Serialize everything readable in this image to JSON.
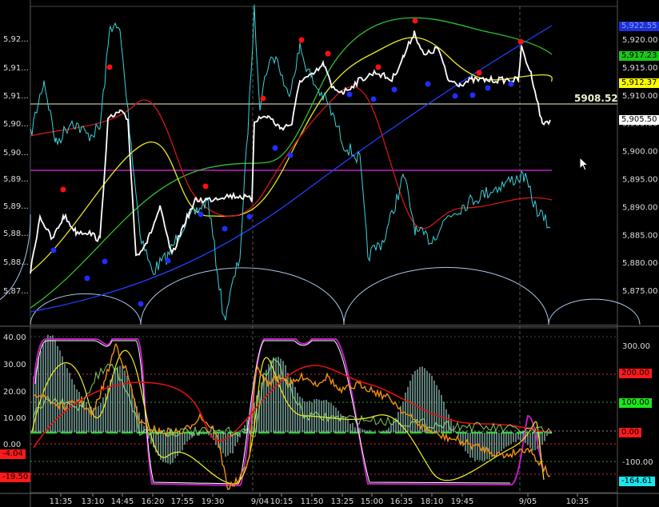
{
  "upper": {
    "y_ticks_left": [
      "5,92...",
      "5,91...",
      "5,91...",
      "5,90...",
      "5,90...",
      "5,89...",
      "5,89...",
      "5,88...",
      "5,88...",
      "5,87..."
    ],
    "y_ticks_right": [
      "5,920.00",
      "5,915.00",
      "5,910.00",
      "5,905.00",
      "5,900.00",
      "5,895.00",
      "5,890.00",
      "5,885.00",
      "5,880.00",
      "5,875.00"
    ],
    "ylim": [
      5871,
      5925
    ],
    "price_line_label": "5908.52",
    "price_line_value": 5908.52,
    "magenta_line_value": 5896.2,
    "right_tags": [
      {
        "text": "5,922.55",
        "value": 5922.55,
        "bg": "#1f2fd8",
        "fg": "#8aa0ff"
      },
      {
        "text": "5,917.23",
        "value": 5917.23,
        "bg": "#19c819",
        "fg": "#000000"
      },
      {
        "text": "5,912.37",
        "value": 5912.37,
        "bg": "#ffff00",
        "fg": "#000000"
      },
      {
        "text": "5,905.50",
        "value": 5905.5,
        "bg": "#ffffff",
        "fg": "#000000"
      }
    ]
  },
  "lower": {
    "y_ticks_left": [
      "40.00",
      "30.00",
      "20.00",
      "10.00",
      "0.00"
    ],
    "y_ticks_right": [
      "300.00",
      "-100.00"
    ],
    "left_tags": [
      {
        "text": "-4.04",
        "bg": "#ff1a1a",
        "fg": "#000000"
      },
      {
        "text": "-19.50",
        "bg": "#ff1a1a",
        "fg": "#000000"
      }
    ],
    "right_tags": [
      {
        "text": "200.00",
        "bg": "#ff1a1a",
        "fg": "#000000"
      },
      {
        "text": "100.00",
        "bg": "#19e619",
        "fg": "#000000"
      },
      {
        "text": "0.00",
        "bg": "#ff1a1a",
        "fg": "#000000"
      },
      {
        "text": "-164.61",
        "bg": "#19e6f0",
        "fg": "#000000"
      }
    ]
  },
  "x_ticks": [
    "11:35",
    "13:10",
    "14:45",
    "16:20",
    "17:55",
    "19:30",
    "9/04",
    "10:15",
    "11:50",
    "13:25",
    "15:00",
    "16:35",
    "18:10",
    "19:45",
    "9/05",
    "10:35"
  ],
  "colors": {
    "price": "#ffffff",
    "cyan": "#3cd2d8",
    "red": "#d01818",
    "yellow": "#e8e820",
    "green": "#30c030",
    "blue": "#2040ff",
    "magenta": "#c020c0",
    "arc": "#a8c8e8"
  },
  "chart_data": {
    "type": "line",
    "x": [
      "11:35",
      "13:10",
      "14:45",
      "16:20",
      "17:55",
      "19:30",
      "9/04",
      "10:15",
      "11:50",
      "13:25",
      "15:00",
      "16:35",
      "18:10",
      "19:45",
      "9/05",
      "10:35"
    ],
    "series": [
      {
        "values": [
          5884,
          5880,
          5905,
          5882,
          5889,
          5891,
          5905,
          5912,
          5912,
          5912,
          5914,
          5922,
          5913,
          5913,
          5906
        ]
      }
    ],
    "ylim": [
      5871,
      5925
    ]
  }
}
